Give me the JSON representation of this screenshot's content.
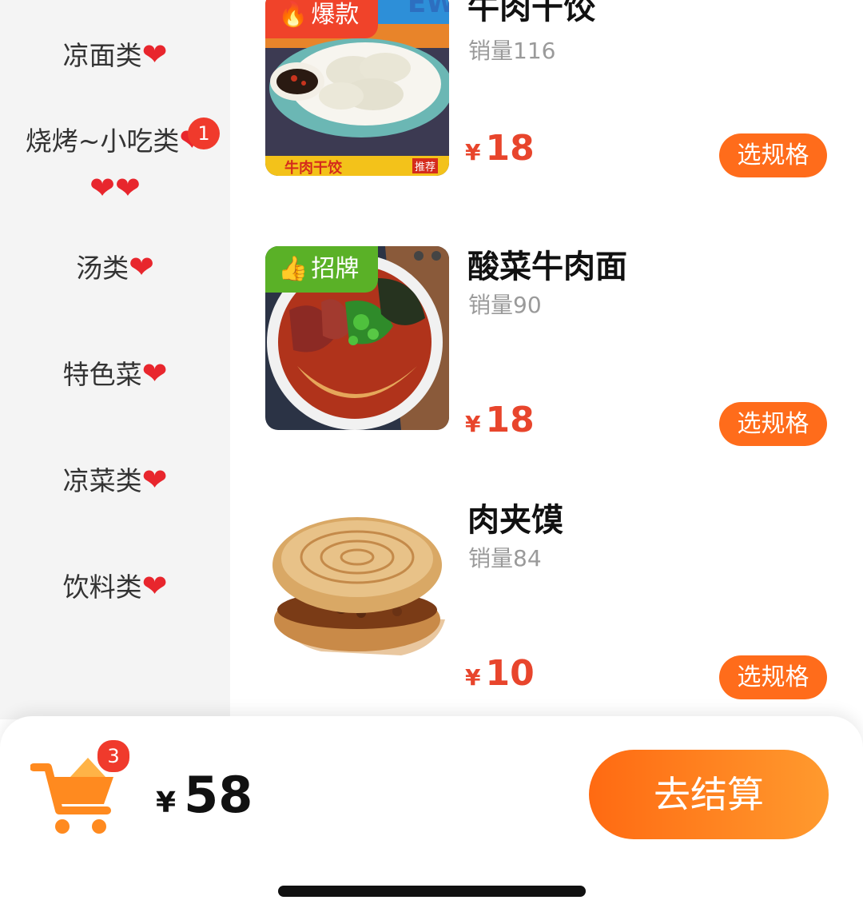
{
  "sidebar": {
    "categories": [
      {
        "label": "凉面类",
        "icon": "heart-icon"
      },
      {
        "label": "烧烤~小吃类",
        "icon": "heart-icon",
        "badge": "1"
      },
      {
        "label": "汤类",
        "icon": "heart-icon"
      },
      {
        "label": "特色菜",
        "icon": "heart-icon"
      },
      {
        "label": "凉菜类",
        "icon": "heart-icon"
      },
      {
        "label": "饮料类",
        "icon": "heart-icon"
      }
    ]
  },
  "products": [
    {
      "name": "牛肉干饺",
      "sales": "销量116",
      "currency": "¥",
      "price": "18",
      "tag": "爆款",
      "tag_icon": "fire-icon",
      "tag_color": "#f0432a",
      "image_text": "牛肉干饺",
      "image_text2": "推荐",
      "image_banner": "EW",
      "button": "选规格"
    },
    {
      "name": "酸菜牛肉面",
      "sales": "销量90",
      "currency": "¥",
      "price": "18",
      "tag": "招牌",
      "tag_icon": "thumbs-up-icon",
      "tag_color": "#5ab127",
      "button": "选规格"
    },
    {
      "name": "肉夹馍",
      "sales": "销量84",
      "currency": "¥",
      "price": "10",
      "button": "选规格"
    }
  ],
  "cart": {
    "count": "3",
    "currency": "¥",
    "total": "58",
    "checkout_label": "去结算"
  },
  "colors": {
    "accent": "#ff6c1b",
    "price": "#e8452c",
    "badge": "#f03a2c",
    "heart": "#e8262d"
  }
}
